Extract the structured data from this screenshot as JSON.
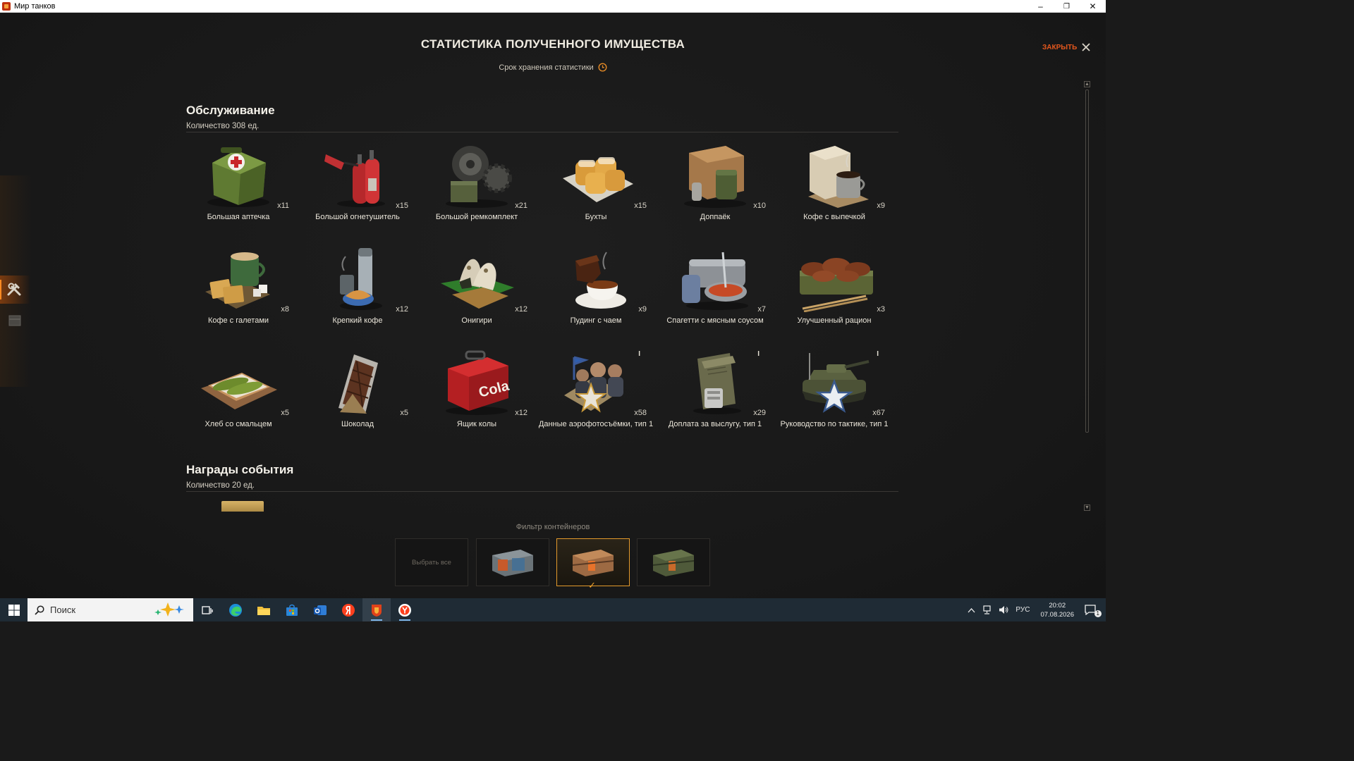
{
  "window": {
    "title": "Мир танков",
    "minimize": "–",
    "restore": "❐",
    "close": "✕"
  },
  "header": {
    "title": "СТАТИСТИКА ПОЛУЧЕННОГО ИМУЩЕСТВА",
    "subtitle": "Срок хранения статистики",
    "close_label": "ЗАКРЫТЬ"
  },
  "sections": [
    {
      "title": "Обслуживание",
      "count": "Количество 308 ед.",
      "items": [
        {
          "name": "Большая аптечка",
          "qty": "x11",
          "icon": "first-aid-kit-icon"
        },
        {
          "name": "Большой огнетушитель",
          "qty": "x15",
          "icon": "fire-extinguisher-icon"
        },
        {
          "name": "Большой ремкомплект",
          "qty": "x21",
          "icon": "repair-kit-icon"
        },
        {
          "name": "Бухты",
          "qty": "x15",
          "icon": "buns-icon"
        },
        {
          "name": "Доппаёк",
          "qty": "x10",
          "icon": "extra-ration-icon"
        },
        {
          "name": "Кофе с выпечкой",
          "qty": "x9",
          "icon": "coffee-pastry-icon"
        },
        {
          "name": "Кофе с галетами",
          "qty": "x8",
          "icon": "coffee-crackers-icon"
        },
        {
          "name": "Крепкий кофе",
          "qty": "x12",
          "icon": "strong-coffee-icon"
        },
        {
          "name": "Онигири",
          "qty": "x12",
          "icon": "onigiri-icon"
        },
        {
          "name": "Пудинг с чаем",
          "qty": "x9",
          "icon": "pudding-tea-icon"
        },
        {
          "name": "Спагетти с мясным соусом",
          "qty": "x7",
          "icon": "spaghetti-icon"
        },
        {
          "name": "Улучшенный рацион",
          "qty": "x3",
          "icon": "improved-ration-icon"
        },
        {
          "name": "Хлеб со смальцем",
          "qty": "x5",
          "icon": "bread-lard-icon"
        },
        {
          "name": "Шоколад",
          "qty": "x5",
          "icon": "chocolate-icon"
        },
        {
          "name": "Ящик колы",
          "qty": "x12",
          "icon": "cola-box-icon",
          "cola_text": "Cola"
        },
        {
          "name": "Данные аэрофотосъёмки, тип 1",
          "qty": "x58",
          "icon": "aerial-data-icon",
          "info": "I"
        },
        {
          "name": "Доплата за выслугу, тип 1",
          "qty": "x29",
          "icon": "seniority-pay-icon",
          "info": "I"
        },
        {
          "name": "Руководство по тактике, тип 1",
          "qty": "x67",
          "icon": "tactics-manual-icon",
          "info": "I"
        }
      ]
    },
    {
      "title": "Награды события",
      "count": "Количество 20 ед."
    }
  ],
  "filter": {
    "label": "Фильтр контейнеров",
    "select_all": "Выбрать все",
    "boxes": [
      {
        "icon": "container-blue-icon",
        "selected": false
      },
      {
        "icon": "container-orange-icon",
        "selected": true
      },
      {
        "icon": "container-green-icon",
        "selected": false
      }
    ],
    "checkmark": "✓"
  },
  "colors": {
    "accent": "#e4571d",
    "selected_border": "#e49a2c",
    "text": "#ebe6da"
  },
  "taskbar": {
    "search_placeholder": "Поиск",
    "language": "РУС",
    "time": "20:02",
    "date": "07.08.2026",
    "notification_count": "1"
  }
}
